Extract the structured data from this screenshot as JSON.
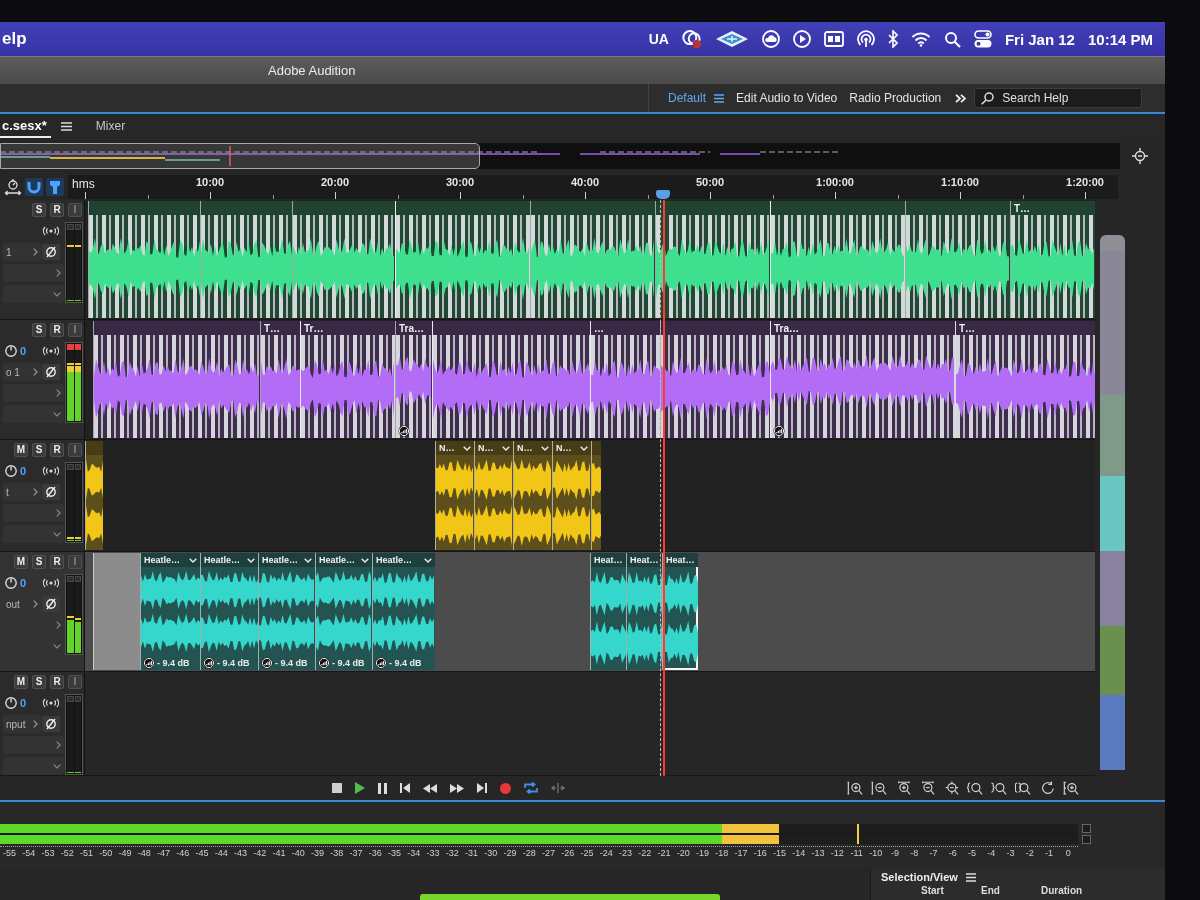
{
  "menu_bar": {
    "app_menu": "elp",
    "status_text": "UA",
    "date": "Fri Jan 12",
    "time": "10:14 PM"
  },
  "window": {
    "title": "Adobe Audition"
  },
  "workspaces": [
    {
      "label": "Default",
      "selected": true
    },
    {
      "label": "Edit Audio to Video",
      "selected": false
    },
    {
      "label": "Radio Production",
      "selected": false
    }
  ],
  "search": {
    "placeholder": "Search Help"
  },
  "editor_tabs": [
    {
      "label": "c.sesx*",
      "selected": true
    },
    {
      "label": "Mixer",
      "selected": false
    }
  ],
  "timeline_tools": [
    {
      "on": false
    },
    {
      "on": true
    },
    {
      "on": true
    }
  ],
  "ruler": {
    "unit": "hms",
    "ticks": [
      "10:00",
      "20:00",
      "30:00",
      "40:00",
      "50:00",
      "1:00:00",
      "1:10:00",
      "1:20:00"
    ]
  },
  "tracks": [
    {
      "color": "#3ee08f",
      "stereo": false,
      "selected": false,
      "buttons": [
        "S",
        "R",
        "I"
      ],
      "input": "1",
      "meter": {
        "clipped": false,
        "channels": [
          {
            "level": 0,
            "peak": {
              "level": 0.79
            }
          },
          {
            "level": 0,
            "peak": {
              "level": 0.79
            }
          }
        ]
      },
      "clips": [
        {
          "kind": "dense",
          "selected": false,
          "gain_adjusted": false
        },
        {
          "kind": "dense",
          "selected": false,
          "gain_adjusted": false
        },
        {
          "kind": "dense",
          "selected": false,
          "gain_adjusted": false
        },
        {
          "kind": "dense",
          "selected": false,
          "gain_adjusted": false
        },
        {
          "kind": "dense",
          "selected": false,
          "gain_adjusted": false
        },
        {
          "kind": "dense",
          "selected": false,
          "gain_adjusted": false
        },
        {
          "kind": "dense",
          "selected": false,
          "gain_adjusted": false
        },
        {
          "kind": "dense",
          "selected": false,
          "gain_adjusted": false
        },
        {
          "kind": "dense",
          "label": "T…",
          "selected": false,
          "gain_adjusted": false
        }
      ]
    },
    {
      "color": "#b36cf5",
      "stereo": false,
      "selected": false,
      "buttons": [
        "S",
        "R",
        "I"
      ],
      "volume": "0",
      "input": "o 1",
      "meter": {
        "clipped": true,
        "channels": [
          {
            "level": 0.78,
            "peak": {
              "level": 0.82
            }
          },
          {
            "level": 0.78,
            "peak": {
              "level": 0.82
            }
          }
        ]
      },
      "clips": [
        {
          "kind": "dense",
          "selected": false,
          "gain_adjusted": false
        },
        {
          "kind": "dense",
          "label": "T…",
          "selected": false,
          "gain_adjusted": false
        },
        {
          "kind": "dense",
          "label": "Tr…",
          "selected": false,
          "gain_adjusted": false
        },
        {
          "kind": "dense",
          "label": "Tra…",
          "selected": false,
          "gain_adjusted": true
        },
        {
          "kind": "dense",
          "selected": false,
          "gain_adjusted": false
        },
        {
          "kind": "dense",
          "label": "…",
          "selected": false,
          "gain_adjusted": false
        },
        {
          "kind": "dense",
          "selected": false,
          "gain_adjusted": false
        },
        {
          "kind": "dense",
          "label": "Tra…",
          "selected": false,
          "gain_adjusted": true
        },
        {
          "kind": "dense",
          "label": "T…",
          "selected": false,
          "gain_adjusted": false
        }
      ]
    },
    {
      "color": "#f2c617",
      "stereo": true,
      "selected": false,
      "buttons": [
        "M",
        "S",
        "R",
        "I"
      ],
      "volume": "0",
      "input": "t",
      "meter": {
        "clipped": false,
        "channels": [
          {
            "level": 0,
            "peak": {
              "level": 0.04
            }
          },
          {
            "level": 0,
            "peak": {
              "level": 0.04
            }
          }
        ]
      },
      "clips": [
        {
          "kind": "waveform",
          "selected": false,
          "gain_adjusted": false
        },
        {
          "kind": "waveform",
          "label": "N…",
          "selected": false,
          "gain_adjusted": false
        },
        {
          "kind": "waveform",
          "label": "N…",
          "selected": false,
          "gain_adjusted": false
        },
        {
          "kind": "waveform",
          "label": "N…",
          "selected": false,
          "gain_adjusted": false
        },
        {
          "kind": "waveform",
          "label": "N…",
          "selected": false,
          "gain_adjusted": false
        },
        {
          "kind": "waveform",
          "selected": false,
          "gain_adjusted": false
        }
      ]
    },
    {
      "color": "#35d6cc",
      "stereo": true,
      "selected": true,
      "buttons": [
        "M",
        "S",
        "R",
        "I"
      ],
      "volume": "0",
      "input": "out",
      "meter": {
        "clipped": false,
        "channels": [
          {
            "level": 0.47,
            "peak": {
              "level": 0.52
            }
          },
          {
            "level": 0.44,
            "peak": {
              "level": 0.49
            }
          }
        ]
      },
      "clips": [
        {
          "kind": "empty",
          "selected": false,
          "gain_adjusted": false
        },
        {
          "kind": "waveform",
          "label": "Heatle…",
          "gain": "- 9.4 dB",
          "selected": false,
          "gain_adjusted": true
        },
        {
          "kind": "waveform",
          "label": "Heatle…",
          "gain": "- 9.4 dB",
          "selected": false,
          "gain_adjusted": true
        },
        {
          "kind": "waveform",
          "label": "Heatle…",
          "gain": "- 9.4 dB",
          "selected": false,
          "gain_adjusted": true
        },
        {
          "kind": "waveform",
          "label": "Heatle…",
          "gain": "- 9.4 dB",
          "selected": false,
          "gain_adjusted": true
        },
        {
          "kind": "waveform",
          "label": "Heatle…",
          "gain": "- 9.4 dB",
          "selected": false,
          "gain_adjusted": true
        },
        {
          "kind": "waveform",
          "label": "Heat…",
          "selected": false,
          "gain_adjusted": false
        },
        {
          "kind": "waveform",
          "label": "Heat…",
          "selected": false,
          "gain_adjusted": false
        },
        {
          "kind": "waveform",
          "label": "Heat…",
          "selected": true,
          "gain_adjusted": false
        }
      ]
    },
    {
      "selected": false,
      "buttons": [
        "M",
        "S",
        "R",
        "I"
      ],
      "volume": "0",
      "input": "nput",
      "meter": {
        "clipped": false,
        "channels": [
          {
            "level": 0
          },
          {
            "level": 0
          }
        ]
      }
    }
  ],
  "transport": {
    "loop": {
      "on": true
    }
  },
  "level_meter": {
    "channels": [
      {
        "level": 0.723
      },
      {
        "level": 0.723
      }
    ],
    "peak": {
      "level": 0.795
    },
    "scale": [
      "-55",
      "-54",
      "-53",
      "-52",
      "-51",
      "-50",
      "-49",
      "-48",
      "-47",
      "-46",
      "-45",
      "-44",
      "-43",
      "-42",
      "-41",
      "-40",
      "-39",
      "-38",
      "-37",
      "-36",
      "-35",
      "-34",
      "-33",
      "-32",
      "-31",
      "-30",
      "-29",
      "-28",
      "-27",
      "-26",
      "-25",
      "-24",
      "-23",
      "-22",
      "-21",
      "-20",
      "-19",
      "-18",
      "-17",
      "-16",
      "-15",
      "-14",
      "-13",
      "-12",
      "-11",
      "-10",
      "-9",
      "-8",
      "-7",
      "-6",
      "-5",
      "-4",
      "-3",
      "-2",
      "-1",
      "0"
    ]
  },
  "selection_view": {
    "title": "Selection/View",
    "columns": [
      "Start",
      "End",
      "Duration"
    ]
  }
}
